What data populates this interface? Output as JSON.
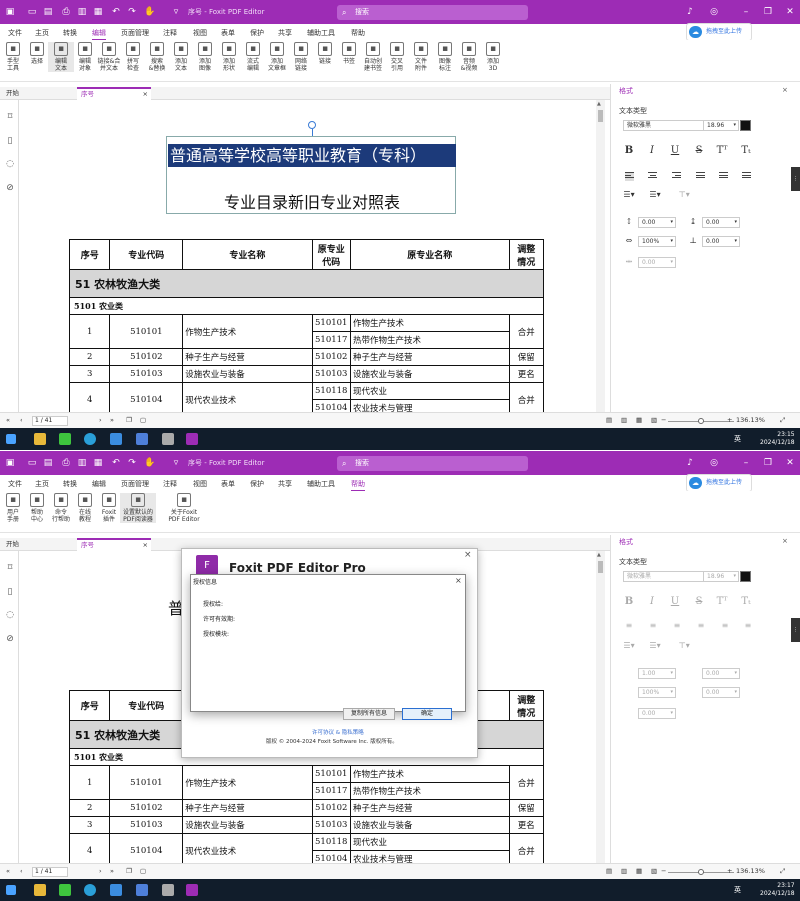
{
  "app": {
    "title": "序号 - Foxit PDF Editor",
    "search_placeholder": "搜索",
    "upload_label": "拖拽至此上传"
  },
  "menus": [
    "文件",
    "主页",
    "转换",
    "编辑",
    "页面管理",
    "注释",
    "视图",
    "表单",
    "保护",
    "共享",
    "辅助工具",
    "帮助"
  ],
  "screen1": {
    "active_menu": "编辑",
    "ribbon": [
      {
        "label": "手型\n工具",
        "icon": "hand-icon"
      },
      {
        "label": "选择",
        "icon": "cursor-icon"
      },
      {
        "label": "编辑\n文本",
        "icon": "edit-text-icon"
      },
      {
        "label": "编辑\n对象",
        "icon": "edit-object-icon"
      },
      {
        "label": "链接&合\n并文本",
        "icon": "link-text-icon"
      },
      {
        "label": "拼写\n检查",
        "icon": "spellcheck-icon"
      },
      {
        "label": "搜索\n&替换",
        "icon": "search-replace-icon"
      },
      {
        "label": "添加\n文本",
        "icon": "add-text-icon"
      },
      {
        "label": "添加\n图像",
        "icon": "add-image-icon"
      },
      {
        "label": "添加\n形状",
        "icon": "add-shape-icon"
      },
      {
        "label": "流式\n编辑",
        "icon": "flow-edit-icon"
      },
      {
        "label": "添加\n文章框",
        "icon": "article-icon"
      },
      {
        "label": "网络\n链接",
        "icon": "web-link-icon"
      },
      {
        "label": "链接",
        "icon": "link-icon"
      },
      {
        "label": "书签",
        "icon": "bookmark-icon"
      },
      {
        "label": "自动创\n建书签",
        "icon": "auto-bookmark-icon"
      },
      {
        "label": "交叉\n引用",
        "icon": "cross-ref-icon"
      },
      {
        "label": "文件\n附件",
        "icon": "attachment-icon"
      },
      {
        "label": "图像\n标注",
        "icon": "image-annot-icon"
      },
      {
        "label": "音频\n&视频",
        "icon": "media-icon"
      },
      {
        "label": "添加\n3D",
        "icon": "3d-icon"
      }
    ],
    "clock": {
      "time": "23:15",
      "date": "2024/12/18"
    }
  },
  "screen2": {
    "active_menu": "帮助",
    "ribbon": [
      {
        "label": "用户\n手册",
        "icon": "manual-icon"
      },
      {
        "label": "帮助\n中心",
        "icon": "help-icon"
      },
      {
        "label": "命令\n行帮助",
        "icon": "cmd-help-icon"
      },
      {
        "label": "在线\n教程",
        "icon": "tutorial-icon"
      },
      {
        "label": "Foxit\n插件",
        "icon": "plugin-icon"
      },
      {
        "label": "设置默认的\nPDF阅读器",
        "icon": "default-reader-icon"
      },
      {
        "label": "关于Foxit\nPDF Editor",
        "icon": "about-icon"
      }
    ],
    "clock": {
      "time": "23:17",
      "date": "2024/12/18"
    },
    "about_dialog": {
      "product": "Foxit PDF Editor Pro",
      "links": "许可协议 & 隐私策略",
      "copyright": "版权 © 2004-2024 Foxit Software Inc. 版权所有。"
    },
    "license_dialog": {
      "title": "授权信息",
      "rows": [
        "授权给:",
        "许可有效期:",
        "授权模块:"
      ],
      "copy_button": "复制所有信息",
      "ok_button": "确定"
    }
  },
  "tabs": {
    "start": "开始",
    "doc": "序号"
  },
  "panel": {
    "tab": "格式",
    "section": "文本类型",
    "font": "微软雅黑",
    "size": "18.96",
    "line_spacing": "0.00",
    "para_spacing": "0.00",
    "scale": "100%",
    "baseline": "0.00",
    "char_spacing": "0.00",
    "word_spacing": "0.00",
    "text_color": "#111111"
  },
  "s2panel": {
    "line_spacing": "1.00"
  },
  "status": {
    "page": "1 / 41",
    "zoom": "136.13%"
  },
  "document": {
    "title_line": "普通高等学校高等职业教育（专科）",
    "subtitle": "专业目录新旧专业对照表",
    "headers": [
      "序号",
      "专业代码",
      "专业名称",
      "原专业\n代码",
      "原专业名称",
      "调整\n情况"
    ],
    "category": "51 农林牧渔大类",
    "subcategory": "5101 农业类",
    "rows": [
      {
        "no": "1",
        "code": "510101",
        "name": "作物生产技术",
        "old": [
          [
            "510101",
            "作物生产技术"
          ],
          [
            "510117",
            "热带作物生产技术"
          ]
        ],
        "adj": "合并"
      },
      {
        "no": "2",
        "code": "510102",
        "name": "种子生产与经营",
        "old": [
          [
            "510102",
            "种子生产与经营"
          ]
        ],
        "adj": "保留"
      },
      {
        "no": "3",
        "code": "510103",
        "name": "设施农业与装备",
        "old": [
          [
            "510103",
            "设施农业与装备"
          ]
        ],
        "adj": "更名"
      },
      {
        "no": "4",
        "code": "510104",
        "name": "现代农业技术",
        "old": [
          [
            "510118",
            "现代农业"
          ],
          [
            "510104",
            "农业技术与管理"
          ]
        ],
        "adj": "合并"
      }
    ]
  },
  "tray": {
    "ime": "英"
  }
}
